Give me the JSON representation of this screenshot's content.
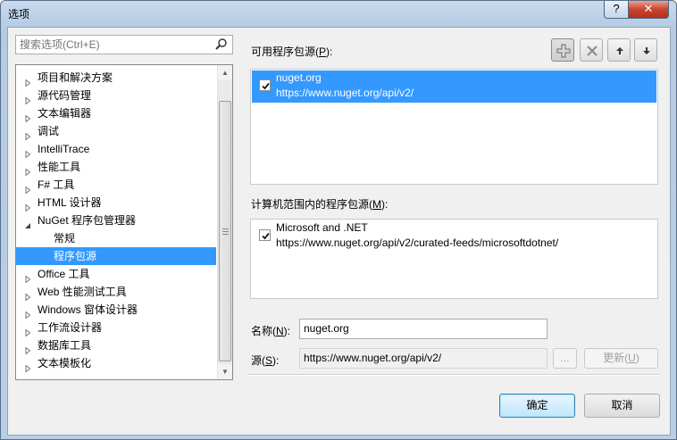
{
  "window": {
    "title": "选项",
    "help_glyph": "?",
    "close_glyph": "✕"
  },
  "search": {
    "placeholder": "搜索选项(Ctrl+E)",
    "value": ""
  },
  "tree": {
    "items": [
      {
        "label": "项目和解决方案",
        "level": 0,
        "expanded": false,
        "selected": false
      },
      {
        "label": "源代码管理",
        "level": 0,
        "expanded": false,
        "selected": false
      },
      {
        "label": "文本编辑器",
        "level": 0,
        "expanded": false,
        "selected": false
      },
      {
        "label": "调试",
        "level": 0,
        "expanded": false,
        "selected": false
      },
      {
        "label": "IntelliTrace",
        "level": 0,
        "expanded": false,
        "selected": false
      },
      {
        "label": "性能工具",
        "level": 0,
        "expanded": false,
        "selected": false
      },
      {
        "label": "F# 工具",
        "level": 0,
        "expanded": false,
        "selected": false
      },
      {
        "label": "HTML 设计器",
        "level": 0,
        "expanded": false,
        "selected": false
      },
      {
        "label": "NuGet 程序包管理器",
        "level": 0,
        "expanded": true,
        "selected": false
      },
      {
        "label": "常规",
        "level": 1,
        "expanded": null,
        "selected": false
      },
      {
        "label": "程序包源",
        "level": 1,
        "expanded": null,
        "selected": true
      },
      {
        "label": "Office 工具",
        "level": 0,
        "expanded": false,
        "selected": false
      },
      {
        "label": "Web 性能测试工具",
        "level": 0,
        "expanded": false,
        "selected": false
      },
      {
        "label": "Windows 窗体设计器",
        "level": 0,
        "expanded": false,
        "selected": false
      },
      {
        "label": "工作流设计器",
        "level": 0,
        "expanded": false,
        "selected": false
      },
      {
        "label": "数据库工具",
        "level": 0,
        "expanded": false,
        "selected": false
      },
      {
        "label": "文本模板化",
        "level": 0,
        "expanded": false,
        "selected": false
      }
    ]
  },
  "available_sources": {
    "label_prefix": "可用程序包源(",
    "label_key": "P",
    "label_suffix": "):",
    "items": [
      {
        "name": "nuget.org",
        "url": "https://www.nuget.org/api/v2/",
        "checked": true,
        "selected": true
      }
    ]
  },
  "machine_sources": {
    "label_prefix": "计算机范围内的程序包源(",
    "label_key": "M",
    "label_suffix": "):",
    "items": [
      {
        "name": "Microsoft and .NET",
        "url": "https://www.nuget.org/api/v2/curated-feeds/microsoftdotnet/",
        "checked": true,
        "selected": false
      }
    ]
  },
  "toolbar": {
    "add_icon": "plus-icon",
    "remove_icon": "x-icon",
    "up_icon": "arrow-up-icon",
    "down_icon": "arrow-down-icon"
  },
  "form": {
    "name_label_prefix": "名称(",
    "name_label_key": "N",
    "name_label_suffix": "):",
    "name_value": "nuget.org",
    "source_label_prefix": "源(",
    "source_label_key": "S",
    "source_label_suffix": "):",
    "source_value": "https://www.nuget.org/api/v2/",
    "browse_label": "...",
    "update_label_prefix": "更新(",
    "update_label_key": "U",
    "update_label_suffix": ")"
  },
  "footer": {
    "ok_label": "确定",
    "cancel_label": "取消"
  },
  "colors": {
    "selection": "#3399ff",
    "dialog_bg": "#f0f0f0",
    "titlebar": "#b9d1ea",
    "close": "#c7412c"
  }
}
